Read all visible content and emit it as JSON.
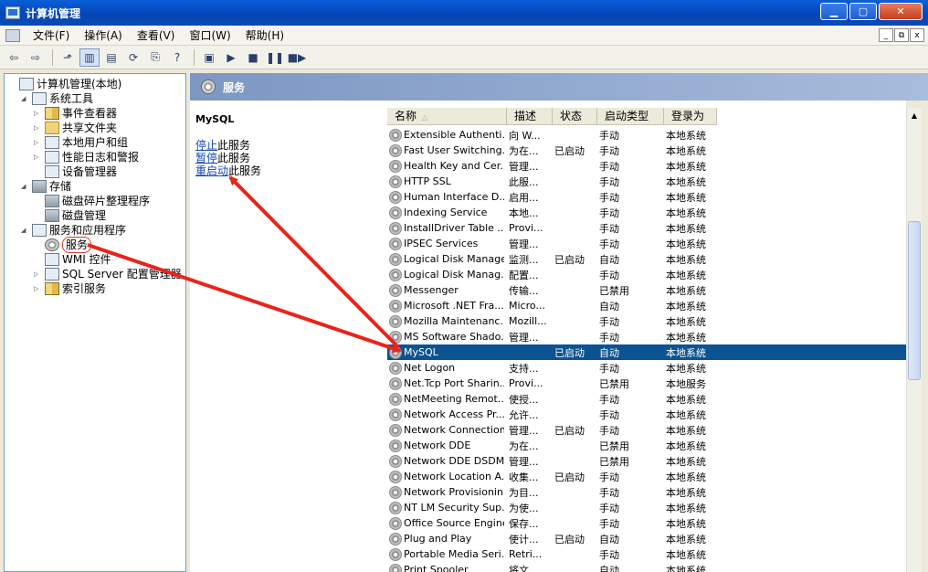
{
  "window": {
    "title": "计算机管理",
    "buttons": {
      "minimize": "▁",
      "maximize": "▢",
      "close": "✕"
    }
  },
  "menubar": {
    "items": [
      "文件(F)",
      "操作(A)",
      "查看(V)",
      "窗口(W)",
      "帮助(H)"
    ],
    "child_buttons": {
      "minimize": "_",
      "restore": "⧉",
      "close": "x"
    }
  },
  "toolbar": {
    "buttons": [
      {
        "name": "back-icon",
        "glyph": "⇦"
      },
      {
        "name": "forward-icon",
        "glyph": "⇨"
      },
      {
        "name": "up-folder-icon",
        "glyph": "⬏"
      },
      {
        "name": "show-hide-tree-icon",
        "glyph": "▥"
      },
      {
        "name": "properties-icon",
        "glyph": "▤"
      },
      {
        "name": "refresh-icon",
        "glyph": "⟳"
      },
      {
        "name": "export-list-icon",
        "glyph": "⎘"
      },
      {
        "name": "help-icon",
        "glyph": "?"
      },
      {
        "name": "show-action-pane-icon",
        "glyph": "▣"
      },
      {
        "name": "start-service-icon",
        "glyph": "▶"
      },
      {
        "name": "stop-service-icon",
        "glyph": "■"
      },
      {
        "name": "pause-service-icon",
        "glyph": "❚❚"
      },
      {
        "name": "restart-service-icon",
        "glyph": "■▶"
      }
    ]
  },
  "tree": [
    {
      "label": "计算机管理(本地)",
      "level": 0,
      "expander": "",
      "icon": "computer"
    },
    {
      "label": "系统工具",
      "level": 1,
      "expander": "◢",
      "icon": "tools"
    },
    {
      "label": "事件查看器",
      "level": 2,
      "expander": "▷",
      "icon": "book"
    },
    {
      "label": "共享文件夹",
      "level": 2,
      "expander": "▷",
      "icon": "folder"
    },
    {
      "label": "本地用户和组",
      "level": 2,
      "expander": "▷",
      "icon": "users"
    },
    {
      "label": "性能日志和警报",
      "level": 2,
      "expander": "▷",
      "icon": "chart"
    },
    {
      "label": "设备管理器",
      "level": 2,
      "expander": "",
      "icon": "device"
    },
    {
      "label": "存储",
      "level": 1,
      "expander": "◢",
      "icon": "disk"
    },
    {
      "label": "磁盘碎片整理程序",
      "level": 2,
      "expander": "",
      "icon": "disk"
    },
    {
      "label": "磁盘管理",
      "level": 2,
      "expander": "",
      "icon": "disk"
    },
    {
      "label": "服务和应用程序",
      "level": 1,
      "expander": "◢",
      "icon": "tools"
    },
    {
      "label": "服务",
      "level": 2,
      "expander": "",
      "icon": "gear",
      "selected": true
    },
    {
      "label": "WMI 控件",
      "level": 2,
      "expander": "",
      "icon": "device"
    },
    {
      "label": "SQL Server 配置管理器",
      "level": 2,
      "expander": "▷",
      "icon": "device"
    },
    {
      "label": "索引服务",
      "level": 2,
      "expander": "▷",
      "icon": "book"
    }
  ],
  "panel": {
    "title": "服务"
  },
  "description": {
    "service_name": "MySQL",
    "actions": [
      {
        "link": "停止",
        "rest": "此服务"
      },
      {
        "link": "暂停",
        "rest": "此服务"
      },
      {
        "link": "重启动",
        "rest": "此服务"
      }
    ]
  },
  "list": {
    "columns": [
      "名称",
      "描述",
      "状态",
      "启动类型",
      "登录为"
    ],
    "rows": [
      {
        "name": "Extensible Authenti...",
        "desc": "向 W...",
        "status": "",
        "startup": "手动",
        "logon": "本地系统"
      },
      {
        "name": "Fast User Switching...",
        "desc": "为在...",
        "status": "已启动",
        "startup": "手动",
        "logon": "本地系统"
      },
      {
        "name": "Health Key and Cer...",
        "desc": "管理...",
        "status": "",
        "startup": "手动",
        "logon": "本地系统"
      },
      {
        "name": "HTTP SSL",
        "desc": "此服...",
        "status": "",
        "startup": "手动",
        "logon": "本地系统"
      },
      {
        "name": "Human Interface D...",
        "desc": "启用...",
        "status": "",
        "startup": "手动",
        "logon": "本地系统"
      },
      {
        "name": "Indexing Service",
        "desc": "本地...",
        "status": "",
        "startup": "手动",
        "logon": "本地系统"
      },
      {
        "name": "InstallDriver Table ...",
        "desc": "Provi...",
        "status": "",
        "startup": "手动",
        "logon": "本地系统"
      },
      {
        "name": "IPSEC Services",
        "desc": "管理...",
        "status": "",
        "startup": "手动",
        "logon": "本地系统"
      },
      {
        "name": "Logical Disk Manager",
        "desc": "监测...",
        "status": "已启动",
        "startup": "自动",
        "logon": "本地系统"
      },
      {
        "name": "Logical Disk Manag...",
        "desc": "配置...",
        "status": "",
        "startup": "手动",
        "logon": "本地系统"
      },
      {
        "name": "Messenger",
        "desc": "传输...",
        "status": "",
        "startup": "已禁用",
        "logon": "本地系统"
      },
      {
        "name": "Microsoft .NET Fra...",
        "desc": "Micro...",
        "status": "",
        "startup": "自动",
        "logon": "本地系统"
      },
      {
        "name": "Mozilla Maintenanc...",
        "desc": "Mozill...",
        "status": "",
        "startup": "手动",
        "logon": "本地系统"
      },
      {
        "name": "MS Software Shado...",
        "desc": "管理...",
        "status": "",
        "startup": "手动",
        "logon": "本地系统"
      },
      {
        "name": "MySQL",
        "desc": "",
        "status": "已启动",
        "startup": "自动",
        "logon": "本地系统",
        "selected": true
      },
      {
        "name": "Net Logon",
        "desc": "支持...",
        "status": "",
        "startup": "手动",
        "logon": "本地系统"
      },
      {
        "name": "Net.Tcp Port Sharin...",
        "desc": "Provi...",
        "status": "",
        "startup": "已禁用",
        "logon": "本地服务"
      },
      {
        "name": "NetMeeting Remot...",
        "desc": "使授...",
        "status": "",
        "startup": "手动",
        "logon": "本地系统"
      },
      {
        "name": "Network Access Pr...",
        "desc": "允许...",
        "status": "",
        "startup": "手动",
        "logon": "本地系统"
      },
      {
        "name": "Network Connections",
        "desc": "管理...",
        "status": "已启动",
        "startup": "手动",
        "logon": "本地系统"
      },
      {
        "name": "Network DDE",
        "desc": "为在...",
        "status": "",
        "startup": "已禁用",
        "logon": "本地系统"
      },
      {
        "name": "Network DDE DSDM",
        "desc": "管理...",
        "status": "",
        "startup": "已禁用",
        "logon": "本地系统"
      },
      {
        "name": "Network Location A...",
        "desc": "收集...",
        "status": "已启动",
        "startup": "手动",
        "logon": "本地系统"
      },
      {
        "name": "Network Provisionin...",
        "desc": "为目...",
        "status": "",
        "startup": "手动",
        "logon": "本地系统"
      },
      {
        "name": "NT LM Security Sup...",
        "desc": "为使...",
        "status": "",
        "startup": "手动",
        "logon": "本地系统"
      },
      {
        "name": "Office Source Engine",
        "desc": "保存...",
        "status": "",
        "startup": "手动",
        "logon": "本地系统"
      },
      {
        "name": "Plug and Play",
        "desc": "使计...",
        "status": "已启动",
        "startup": "自动",
        "logon": "本地系统"
      },
      {
        "name": "Portable Media Seri...",
        "desc": "Retri...",
        "status": "",
        "startup": "手动",
        "logon": "本地系统"
      },
      {
        "name": "Print Spooler",
        "desc": "将文...",
        "status": "",
        "startup": "自动",
        "logon": "本地系统"
      }
    ]
  },
  "colors": {
    "selection": "#0c5391",
    "annotation": "#e8241c",
    "link": "#1646b8"
  }
}
